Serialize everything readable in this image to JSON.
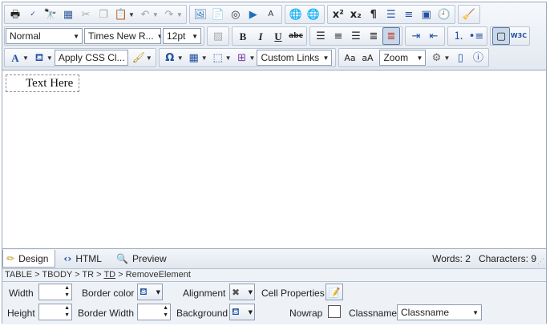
{
  "toolbar": {
    "row1_icons": [
      "print-icon",
      "spellcheck-icon",
      "find-icon",
      "select-all-icon",
      "cut-icon",
      "copy-icon",
      "paste-icon",
      "undo-icon",
      "redo-icon",
      "image-manager-icon",
      "document-manager-icon",
      "flash-manager-icon",
      "media-manager-icon",
      "template-manager-icon",
      "hyperlink-icon",
      "remove-link-icon",
      "superscript-icon",
      "subscript-icon",
      "insert-paragraph-icon",
      "insert-symbol-icon",
      "format-block-icon",
      "insert-snippet-icon",
      "insert-date-icon",
      "format-stripper-icon"
    ],
    "paragraph_style": "Normal",
    "font_name": "Times New R...",
    "font_size": "12pt",
    "css_class": "Apply CSS Cl...",
    "custom_links": "Custom Links",
    "zoom": "Zoom"
  },
  "content": {
    "cell_text": "Text Here"
  },
  "modes": {
    "design": "Design",
    "html": "HTML",
    "preview": "Preview",
    "words": "Words: 2",
    "characters": "Characters: 9"
  },
  "path": {
    "table": "TABLE",
    "tbody": "TBODY",
    "tr": "TR",
    "td": "TD",
    "remove": "RemoveElement",
    "sep": " > "
  },
  "cell_props": {
    "width_label": "Width",
    "height_label": "Height",
    "border_color_label": "Border color",
    "border_width_label": "Border Width",
    "alignment_label": "Alignment",
    "background_label": "Background",
    "cell_properties_label": "Cell Properties",
    "nowrap_label": "Nowrap",
    "classname_label": "Classname",
    "classname_value": "Classname"
  }
}
